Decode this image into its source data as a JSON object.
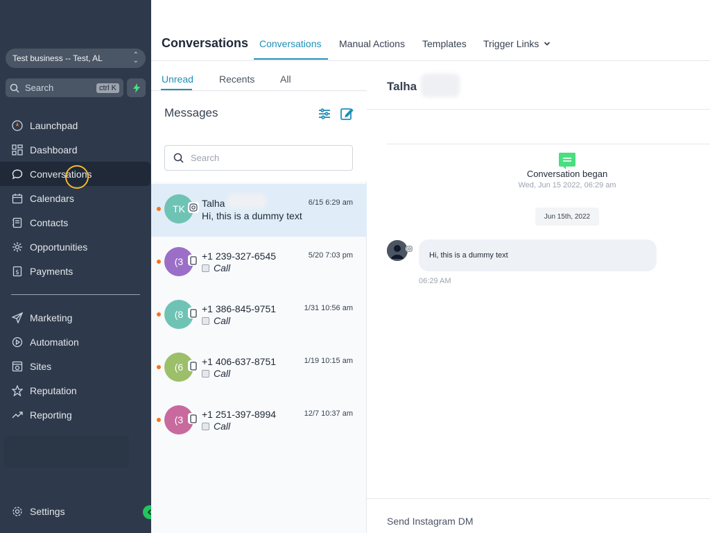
{
  "sidebar": {
    "business": "Test business -- Test, AL",
    "search_placeholder": "Search",
    "search_shortcut": "ctrl K",
    "nav_top": [
      {
        "label": "Launchpad",
        "icon": "rocket-icon"
      },
      {
        "label": "Dashboard",
        "icon": "grid-icon"
      },
      {
        "label": "Conversations",
        "icon": "chat-bubble-icon",
        "active": true
      },
      {
        "label": "Calendars",
        "icon": "calendar-icon"
      },
      {
        "label": "Contacts",
        "icon": "contacts-icon"
      },
      {
        "label": "Opportunities",
        "icon": "opportunities-icon"
      },
      {
        "label": "Payments",
        "icon": "payments-icon"
      }
    ],
    "nav_bottom": [
      {
        "label": "Marketing",
        "icon": "send-icon"
      },
      {
        "label": "Automation",
        "icon": "automation-icon"
      },
      {
        "label": "Sites",
        "icon": "sites-icon"
      },
      {
        "label": "Reputation",
        "icon": "star-icon"
      },
      {
        "label": "Reporting",
        "icon": "trend-icon"
      }
    ],
    "settings_label": "Settings"
  },
  "header": {
    "title": "Conversations",
    "tabs": [
      "Conversations",
      "Manual Actions",
      "Templates",
      "Trigger Links"
    ],
    "active_tab": "Conversations"
  },
  "inbox": {
    "tabs": [
      "Unread",
      "Recents",
      "All"
    ],
    "active_tab": "Unread",
    "title": "Messages",
    "search_placeholder": "Search",
    "conversations": [
      {
        "initials": "TK",
        "color": "#6fc3b4",
        "channel": "instagram-icon",
        "name": "Talha",
        "time": "6/15 6:29 am",
        "preview": "Hi, this is a dummy text",
        "unread": true,
        "selected": true
      },
      {
        "initials": "(3",
        "color": "#9b6fc7",
        "channel": "phone-icon",
        "name": "+1 239-327-6545",
        "time": "5/20 7:03 pm",
        "preview": "Call",
        "unread": true
      },
      {
        "initials": "(8",
        "color": "#6fc3b4",
        "channel": "phone-icon",
        "name": "+1 386-845-9751",
        "time": "1/31 10:56 am",
        "preview": "Call",
        "unread": true
      },
      {
        "initials": "(6",
        "color": "#9cbf6a",
        "channel": "phone-icon",
        "name": "+1 406-637-8751",
        "time": "1/19 10:15 am",
        "preview": "Call",
        "unread": true
      },
      {
        "initials": "(3",
        "color": "#c86a9d",
        "channel": "phone-icon",
        "name": "+1 251-397-8994",
        "time": "12/7 10:37 am",
        "preview": "Call",
        "unread": true
      }
    ]
  },
  "chat": {
    "contact_name": "Talha",
    "began_title": "Conversation began",
    "began_date": "Wed, Jun 15 2022, 06:29 am",
    "date_chip": "Jun 15th, 2022",
    "message_text": "Hi, this is a dummy text",
    "message_time": "06:29 AM",
    "compose_label": "Send Instagram DM"
  },
  "colors": {
    "accent": "#1f8fb8",
    "sidebar_bg": "#2e3a4b",
    "unread_dot": "#f97316",
    "success": "#22c55e"
  }
}
